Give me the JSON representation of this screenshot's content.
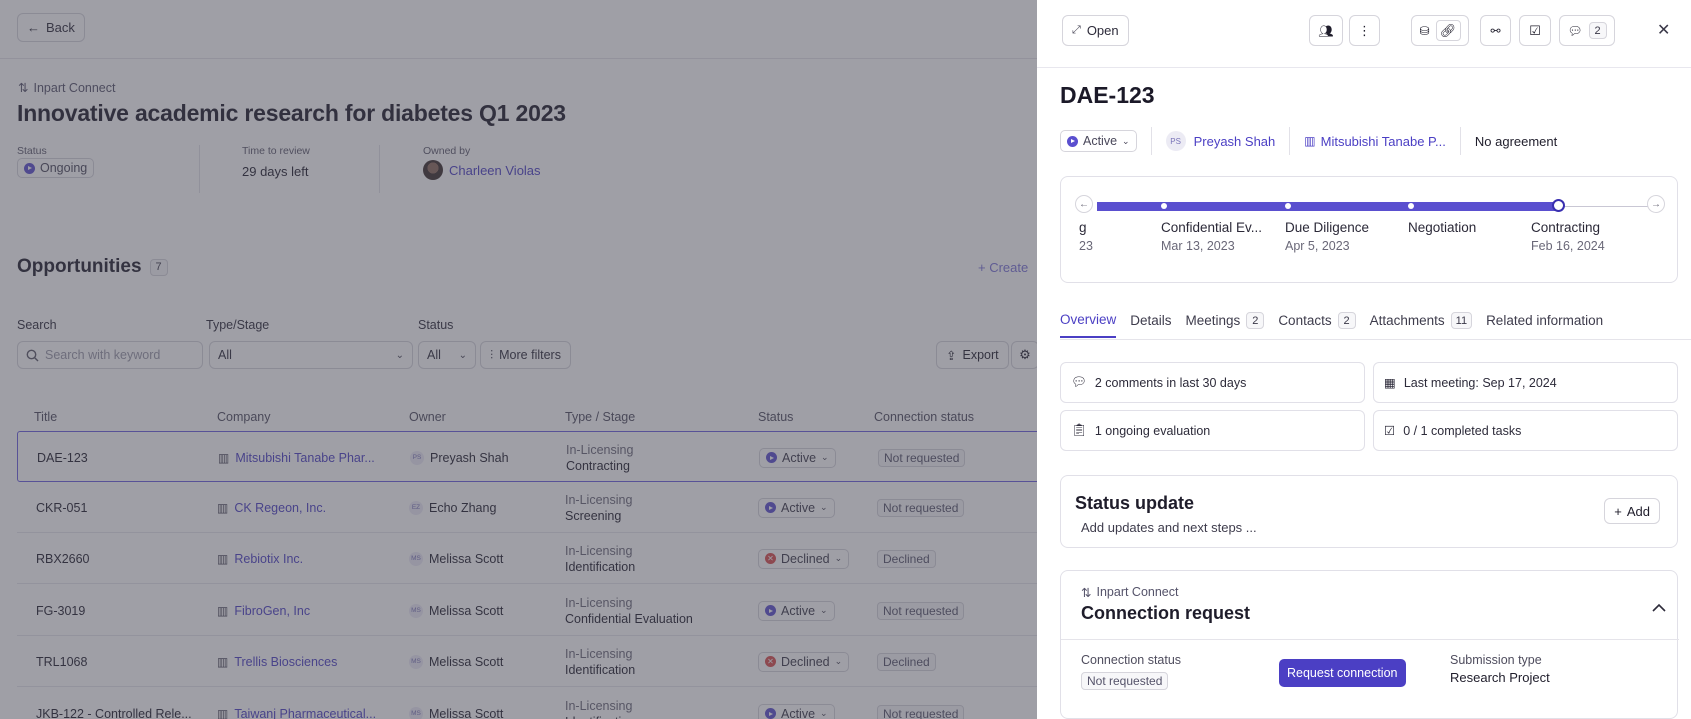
{
  "main": {
    "back_label": "Back",
    "integration_label": "Inpart Connect",
    "title": "Innovative academic research for diabetes Q1 2023",
    "meta": {
      "status_label": "Status",
      "status_value": "Ongoing",
      "time_label": "Time to review",
      "time_value": "29 days left",
      "owner_label": "Owned by",
      "owner_value": "Charleen Violas"
    },
    "opportunities_title": "Opportunities",
    "opportunities_count": "7",
    "create_label": "+ Create",
    "filters": {
      "search_label": "Search",
      "search_placeholder": "Search with keyword",
      "type_label": "Type/Stage",
      "type_value": "All",
      "status_label": "Status",
      "status_value": "All",
      "more_filters": "More filters",
      "export": "Export"
    },
    "columns": [
      "Title",
      "Company",
      "Owner",
      "Type / Stage",
      "Status",
      "Connection status"
    ],
    "rows": [
      {
        "title": "DAE-123",
        "company": "Mitsubishi Tanabe Phar...",
        "owner_initials": "PS",
        "owner": "Preyash Shah",
        "type": "In-Licensing",
        "stage": "Contracting",
        "status": "Active",
        "status_kind": "active",
        "connection": "Not requested"
      },
      {
        "title": "CKR-051",
        "company": "CK Regeon, Inc.",
        "owner_initials": "EZ",
        "owner": "Echo Zhang",
        "type": "In-Licensing",
        "stage": "Screening",
        "status": "Active",
        "status_kind": "active",
        "connection": "Not requested"
      },
      {
        "title": "RBX2660",
        "company": "Rebiotix Inc.",
        "owner_initials": "MS",
        "owner": "Melissa Scott",
        "type": "In-Licensing",
        "stage": "Identification",
        "status": "Declined",
        "status_kind": "declined",
        "connection": "Declined"
      },
      {
        "title": "FG-3019",
        "company": "FibroGen, Inc",
        "owner_initials": "MS",
        "owner": "Melissa Scott",
        "type": "In-Licensing",
        "stage": "Confidential Evaluation",
        "status": "Active",
        "status_kind": "active",
        "connection": "Not requested"
      },
      {
        "title": "TRL1068",
        "company": "Trellis Biosciences",
        "owner_initials": "MS",
        "owner": "Melissa Scott",
        "type": "In-Licensing",
        "stage": "Identification",
        "status": "Declined",
        "status_kind": "declined",
        "connection": "Declined"
      },
      {
        "title": "JKB-122 - Controlled Rele...",
        "company": "Taiwanj Pharmaceutical...",
        "owner_initials": "MS",
        "owner": "Melissa Scott",
        "type": "In-Licensing",
        "stage": "Identification",
        "status": "Active",
        "status_kind": "active",
        "connection": "Not requested"
      }
    ]
  },
  "panel": {
    "open_label": "Open",
    "comments_badge": "2",
    "title": "DAE-123",
    "status": "Active",
    "owner_initials": "PS",
    "owner": "Preyash Shah",
    "company": "Mitsubishi Tanabe P...",
    "agreement": "No agreement",
    "stages": [
      {
        "label": "g",
        "date": "23"
      },
      {
        "label": "Confidential Ev...",
        "date": "Mar 13, 2023"
      },
      {
        "label": "Due Diligence",
        "date": "Apr 5, 2023"
      },
      {
        "label": "Negotiation",
        "date": ""
      },
      {
        "label": "Contracting",
        "date": "Feb 16, 2024"
      }
    ],
    "tabs": [
      {
        "label": "Overview",
        "count": ""
      },
      {
        "label": "Details",
        "count": ""
      },
      {
        "label": "Meetings",
        "count": "2"
      },
      {
        "label": "Contacts",
        "count": "2"
      },
      {
        "label": "Attachments",
        "count": "11"
      },
      {
        "label": "Related information",
        "count": ""
      }
    ],
    "summary": {
      "comments": "2 comments in last 30 days",
      "last_meeting": "Last meeting: Sep 17, 2024",
      "evaluation": "1 ongoing evaluation",
      "tasks": "0 / 1 completed tasks"
    },
    "status_update": {
      "title": "Status update",
      "subtitle": "Add updates and next steps ...",
      "add": "Add"
    },
    "connection": {
      "integration": "Inpart Connect",
      "title": "Connection request",
      "status_label": "Connection status",
      "status_value": "Not requested",
      "request_button": "Request connection",
      "submission_label": "Submission type",
      "submission_value": "Research Project"
    }
  },
  "colors": {
    "accent": "#4b3fc4",
    "active": "#5a4fcf",
    "declined": "#d94b4b",
    "overlay": "#464654"
  }
}
